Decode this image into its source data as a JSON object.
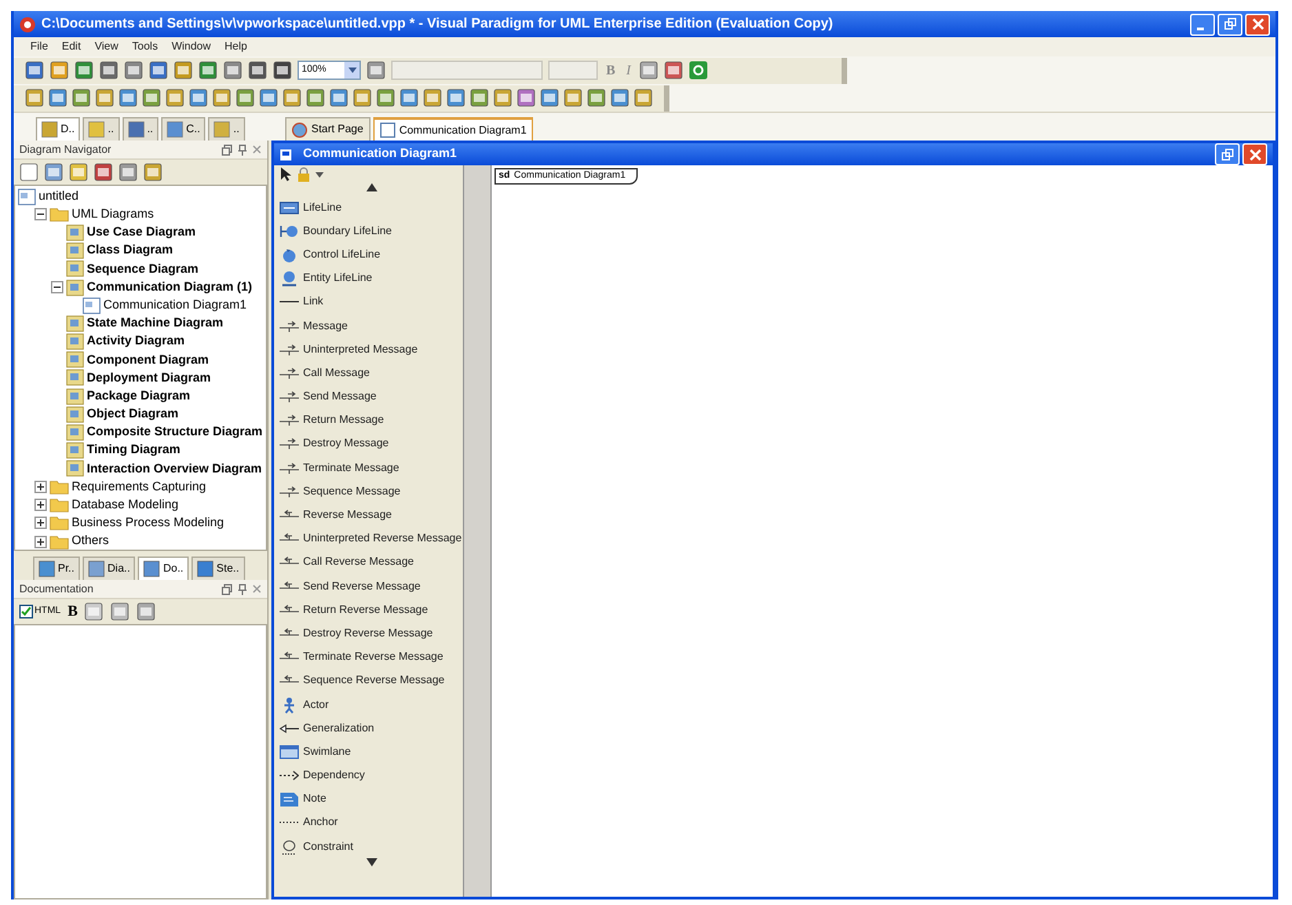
{
  "window": {
    "title": "C:\\Documents and Settings\\v\\vpworkspace\\untitled.vpp * - Visual Paradigm for UML Enterprise Edition (Evaluation Copy)"
  },
  "menu": [
    "File",
    "Edit",
    "View",
    "Tools",
    "Window",
    "Help"
  ],
  "toolbar": {
    "zoom": "100%",
    "format_buttons": [
      "B",
      "I"
    ]
  },
  "left_tabs": [
    {
      "label": "D..",
      "selected": true
    },
    {
      "label": "..",
      "selected": false
    },
    {
      "label": "..",
      "selected": false
    },
    {
      "label": "C..",
      "selected": false
    },
    {
      "label": "..",
      "selected": false
    }
  ],
  "doc_tabs": [
    {
      "label": "Start Page",
      "selected": false
    },
    {
      "label": "Communication Diagram1",
      "selected": true
    }
  ],
  "navigator": {
    "title": "Diagram Navigator",
    "tree": [
      {
        "label": "untitled",
        "kind": "project",
        "children": [
          {
            "label": "UML Diagrams",
            "kind": "folder",
            "expanded": true,
            "children": [
              {
                "label": "Use Case Diagram",
                "kind": "type"
              },
              {
                "label": "Class Diagram",
                "kind": "type"
              },
              {
                "label": "Sequence Diagram",
                "kind": "type"
              },
              {
                "label": "Communication Diagram (1)",
                "kind": "type",
                "expanded": true,
                "children": [
                  {
                    "label": "Communication Diagram1",
                    "kind": "diagram"
                  }
                ]
              },
              {
                "label": "State Machine Diagram",
                "kind": "type"
              },
              {
                "label": "Activity Diagram",
                "kind": "type"
              },
              {
                "label": "Component Diagram",
                "kind": "type"
              },
              {
                "label": "Deployment Diagram",
                "kind": "type"
              },
              {
                "label": "Package Diagram",
                "kind": "type"
              },
              {
                "label": "Object Diagram",
                "kind": "type"
              },
              {
                "label": "Composite Structure Diagram",
                "kind": "type"
              },
              {
                "label": "Timing Diagram",
                "kind": "type"
              },
              {
                "label": "Interaction Overview Diagram",
                "kind": "type"
              }
            ]
          },
          {
            "label": "Requirements Capturing",
            "kind": "folder",
            "expanded": false
          },
          {
            "label": "Database Modeling",
            "kind": "folder",
            "expanded": false
          },
          {
            "label": "Business Process Modeling",
            "kind": "folder",
            "expanded": false
          },
          {
            "label": "Others",
            "kind": "folder",
            "expanded": false
          }
        ]
      }
    ]
  },
  "panel_tabs": [
    {
      "label": "Pr..",
      "selected": false
    },
    {
      "label": "Dia..",
      "selected": false
    },
    {
      "label": "Do..",
      "selected": true
    },
    {
      "label": "Ste..",
      "selected": false
    }
  ],
  "documentation": {
    "title": "Documentation",
    "html_label": "HTML",
    "html_checked": true,
    "bold_button": "B"
  },
  "editor": {
    "title": "Communication Diagram1",
    "frame_label_kind": "sd",
    "frame_label": "Communication Diagram1"
  },
  "palette": [
    {
      "label": "LifeLine",
      "kind": "lifeline"
    },
    {
      "label": "Boundary LifeLine",
      "kind": "boundary"
    },
    {
      "label": "Control LifeLine",
      "kind": "control"
    },
    {
      "label": "Entity LifeLine",
      "kind": "entity"
    },
    {
      "label": "Link",
      "kind": "link"
    },
    {
      "label": "Message",
      "kind": "message"
    },
    {
      "label": "Uninterpreted Message",
      "kind": "message"
    },
    {
      "label": "Call Message",
      "kind": "message"
    },
    {
      "label": "Send Message",
      "kind": "message"
    },
    {
      "label": "Return Message",
      "kind": "message"
    },
    {
      "label": "Destroy Message",
      "kind": "message"
    },
    {
      "label": "Terminate Message",
      "kind": "message"
    },
    {
      "label": "Sequence Message",
      "kind": "message"
    },
    {
      "label": "Reverse Message",
      "kind": "reverse"
    },
    {
      "label": "Uninterpreted Reverse Message",
      "kind": "reverse"
    },
    {
      "label": "Call Reverse Message",
      "kind": "reverse"
    },
    {
      "label": "Send Reverse Message",
      "kind": "reverse"
    },
    {
      "label": "Return Reverse Message",
      "kind": "reverse"
    },
    {
      "label": "Destroy Reverse Message",
      "kind": "reverse"
    },
    {
      "label": "Terminate Reverse Message",
      "kind": "reverse"
    },
    {
      "label": "Sequence Reverse Message",
      "kind": "reverse"
    },
    {
      "label": "Actor",
      "kind": "actor"
    },
    {
      "label": "Generalization",
      "kind": "generalization"
    },
    {
      "label": "Swimlane",
      "kind": "swimlane"
    },
    {
      "label": "Dependency",
      "kind": "dependency"
    },
    {
      "label": "Note",
      "kind": "note"
    },
    {
      "label": "Anchor",
      "kind": "anchor"
    },
    {
      "label": "Constraint",
      "kind": "constraint"
    }
  ]
}
